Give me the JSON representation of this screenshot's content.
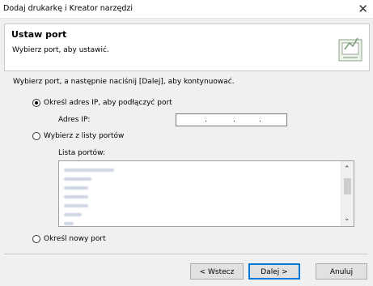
{
  "window": {
    "title": "Dodaj drukarkę i Kreator narzędzi"
  },
  "header": {
    "title": "Ustaw port",
    "subtitle": "Wybierz port, aby ustawić."
  },
  "instruction": "Wybierz port, a następnie naciśnij [Dalej], aby kontynuować.",
  "options": {
    "ip": {
      "label": "Określ adres IP, aby podłączyć port",
      "selected": true
    },
    "ip_field": {
      "label": "Adres IP:",
      "value": ". . ."
    },
    "list": {
      "label": "Wybierz z listy portów",
      "selected": false
    },
    "list_label": "Lista portów:",
    "new": {
      "label": "Określ nowy port",
      "selected": false
    }
  },
  "buttons": {
    "back": "< Wstecz",
    "next": "Dalej >",
    "cancel": "Anuluj"
  },
  "colors": {
    "accent": "#0078d7"
  }
}
